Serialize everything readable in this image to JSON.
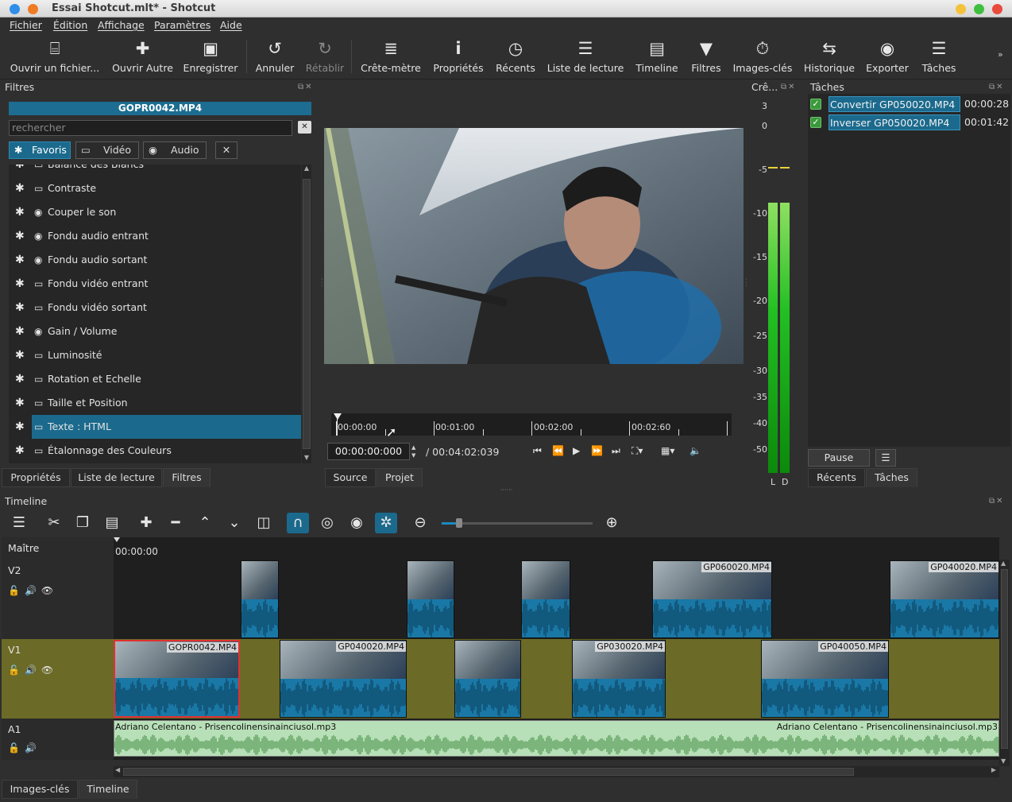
{
  "window": {
    "title": "Essai Shotcut.mlt* - Shotcut"
  },
  "menu": [
    "Fichier",
    "Édition",
    "Affichage",
    "Paramètres",
    "Aide"
  ],
  "toolbar": [
    {
      "label": "Ouvrir un fichier...",
      "icon": "open-file-icon"
    },
    {
      "label": "Ouvrir Autre",
      "icon": "open-other-icon"
    },
    {
      "label": "Enregistrer",
      "icon": "save-icon"
    },
    {
      "label": "Annuler",
      "icon": "undo-icon"
    },
    {
      "label": "Rétablir",
      "icon": "redo-icon"
    },
    {
      "label": "Crête-mètre",
      "icon": "peak-meter-icon"
    },
    {
      "label": "Propriétés",
      "icon": "info-icon"
    },
    {
      "label": "Récents",
      "icon": "clock-icon"
    },
    {
      "label": "Liste de lecture",
      "icon": "list-icon"
    },
    {
      "label": "Timeline",
      "icon": "timeline-icon"
    },
    {
      "label": "Filtres",
      "icon": "filter-icon"
    },
    {
      "label": "Images-clés",
      "icon": "stopwatch-icon"
    },
    {
      "label": "Historique",
      "icon": "history-icon"
    },
    {
      "label": "Exporter",
      "icon": "export-icon"
    },
    {
      "label": "Tâches",
      "icon": "jobs-icon"
    }
  ],
  "filters": {
    "panel_title": "Filtres",
    "clip_name": "GOPR0042.MP4",
    "search_placeholder": "rechercher",
    "chips": [
      "Favoris",
      "Vidéo",
      "Audio"
    ],
    "items": [
      {
        "name": "Balance des Blancs",
        "kind": "video"
      },
      {
        "name": "Contraste",
        "kind": "video"
      },
      {
        "name": "Couper le son",
        "kind": "audio"
      },
      {
        "name": "Fondu audio entrant",
        "kind": "audio"
      },
      {
        "name": "Fondu audio sortant",
        "kind": "audio"
      },
      {
        "name": "Fondu vidéo entrant",
        "kind": "video"
      },
      {
        "name": "Fondu vidéo sortant",
        "kind": "video"
      },
      {
        "name": "Gain / Volume",
        "kind": "audio"
      },
      {
        "name": "Luminosité",
        "kind": "video"
      },
      {
        "name": "Rotation et Echelle",
        "kind": "video"
      },
      {
        "name": "Taille et Position",
        "kind": "video"
      },
      {
        "name": "Texte : HTML",
        "kind": "video",
        "selected": true
      },
      {
        "name": "Étalonnage des Couleurs",
        "kind": "video"
      }
    ],
    "tabs": [
      "Propriétés",
      "Liste de lecture",
      "Filtres"
    ]
  },
  "player": {
    "ruler_labels": [
      "00:00:00",
      "00:01:00",
      "00:02:00",
      "00:02:60"
    ],
    "timecode": "00:00:00:000",
    "duration": "/ 00:04:02:039",
    "tabs": [
      "Source",
      "Projet"
    ]
  },
  "meter": {
    "title": "Crê...",
    "scale": [
      "3",
      "0",
      "-5",
      "-10",
      "-15",
      "-20",
      "-25",
      "-30",
      "-35",
      "-40",
      "-50"
    ],
    "channels": [
      "L",
      "D"
    ]
  },
  "jobs": {
    "title": "Tâches",
    "items": [
      {
        "name": "Convertir GP050020.MP4",
        "time": "00:00:28"
      },
      {
        "name": "Inverser GP050020.MP4",
        "time": "00:01:42"
      }
    ],
    "pause": "Pause",
    "tabs": [
      "Récents",
      "Tâches"
    ]
  },
  "timeline": {
    "title": "Timeline",
    "master": "Maître",
    "start_time": "00:00:00",
    "tracks": [
      "V2",
      "V1",
      "A1"
    ],
    "v2_clips": [
      {
        "name": ""
      },
      {
        "name": ""
      },
      {
        "name": ""
      },
      {
        "name": "GP060020.MP4"
      },
      {
        "name": "GP040020.MP4"
      }
    ],
    "v1_clips": [
      {
        "name": "GOPR0042.MP4"
      },
      {
        "name": "GP040020.MP4"
      },
      {
        "name": ""
      },
      {
        "name": "GP030020.MP4"
      },
      {
        "name": "GP040050.MP4"
      }
    ],
    "audio_left": "Adriano Celentano - Prisencolinensinainciusol.mp3",
    "audio_right": "Adriano Celentano - Prisencolinensinainciusol.mp3"
  },
  "bottom_tabs": [
    "Images-clés",
    "Timeline"
  ]
}
